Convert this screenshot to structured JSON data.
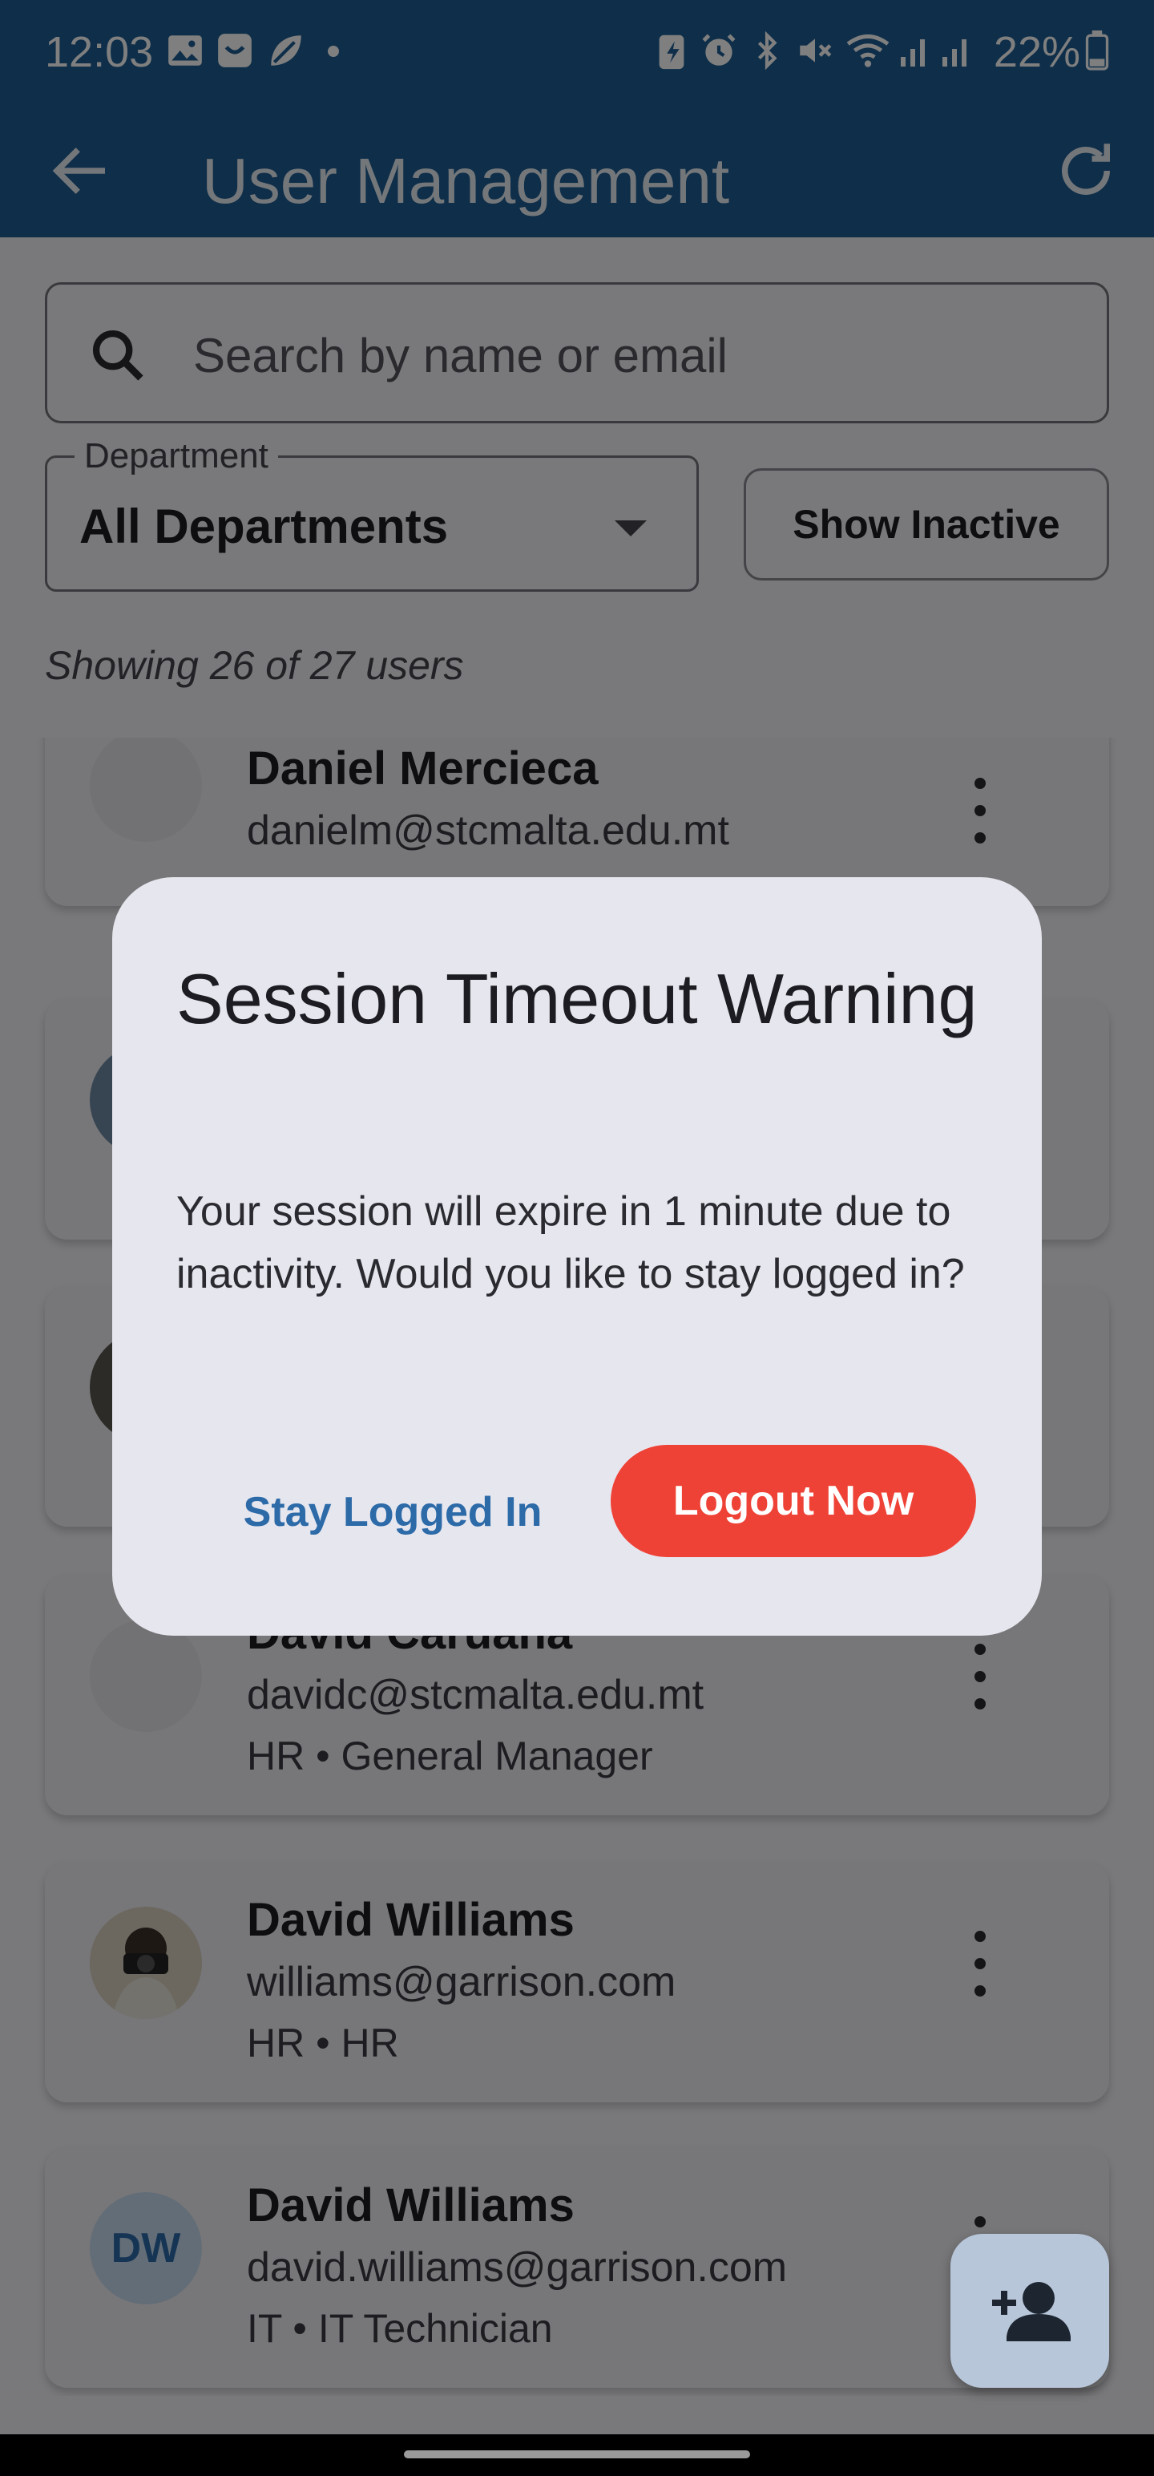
{
  "status_bar": {
    "time": "12:03",
    "battery": "22%"
  },
  "app_bar": {
    "title": "User Management"
  },
  "search": {
    "placeholder": "Search by name or email",
    "value": ""
  },
  "filters": {
    "department_label": "Department",
    "department_value": "All Departments",
    "show_inactive_label": "Show Inactive"
  },
  "summary": {
    "count_text": "Showing 26 of 27 users"
  },
  "users": [
    {
      "name": "Daniel Mercieca",
      "email": "danielm@stcmalta.edu.mt",
      "meta": "",
      "avatar": "photo"
    },
    {
      "name": "",
      "email": "",
      "meta": "",
      "avatar": "photo"
    },
    {
      "name": "",
      "email": "",
      "meta": "",
      "avatar": "photo"
    },
    {
      "name": "David Caruana",
      "email": "davidc@stcmalta.edu.mt",
      "meta": "HR • General Manager",
      "avatar": "photo"
    },
    {
      "name": "David Williams",
      "email": "williams@garrison.com",
      "meta": "HR • HR",
      "avatar": "photo"
    },
    {
      "name": "David Williams",
      "email": "david.williams@garrison.com",
      "meta": "IT • IT Technician",
      "avatar": "initials",
      "initials": "DW"
    }
  ],
  "dialog": {
    "title": "Session Timeout Warning",
    "body": "Your session will expire in 1 minute due to inactivity. Would you like to stay logged in?",
    "stay_label": "Stay Logged In",
    "logout_label": "Logout Now"
  },
  "colors": {
    "app_bar": "#1d5d93",
    "primary": "#2c6aa8",
    "danger": "#ef4236",
    "dialog_bg": "#e6e6ee"
  }
}
